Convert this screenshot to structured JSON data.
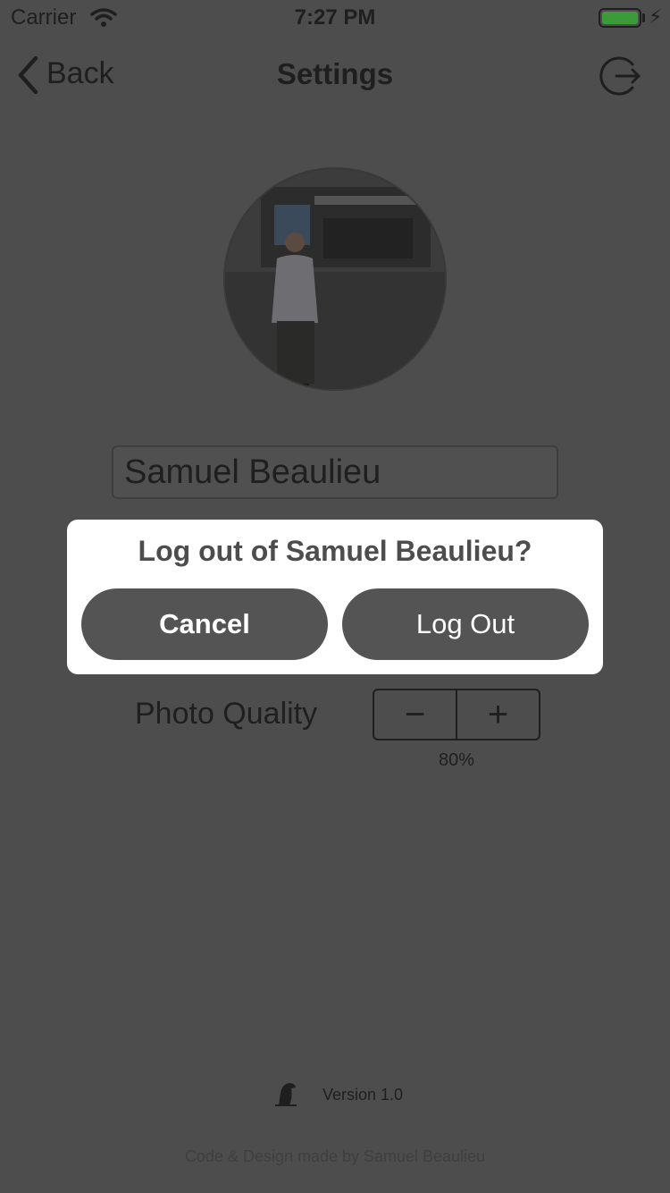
{
  "status_bar": {
    "carrier": "Carrier",
    "time": "7:27 PM"
  },
  "nav": {
    "back_label": "Back",
    "title": "Settings",
    "logout_icon": "logout-icon"
  },
  "profile": {
    "name_value": "Samuel Beaulieu",
    "avatar_icon": "profile-photo"
  },
  "photo_quality": {
    "label": "Photo Quality",
    "decrement": "−",
    "increment": "+",
    "value": "80%",
    "level": 0.8
  },
  "dialog": {
    "title": "Log out of Samuel Beaulieu?",
    "cancel_label": "Cancel",
    "logout_label": "Log Out"
  },
  "footer": {
    "version": "Version 1.0",
    "credits": "Code & Design made by Samuel Beaulieu"
  },
  "colors": {
    "dim_background": "#4d4d4d",
    "dialog_background": "#ffffff",
    "button_fill": "#545454",
    "battery_green": "#3b9b3b"
  }
}
